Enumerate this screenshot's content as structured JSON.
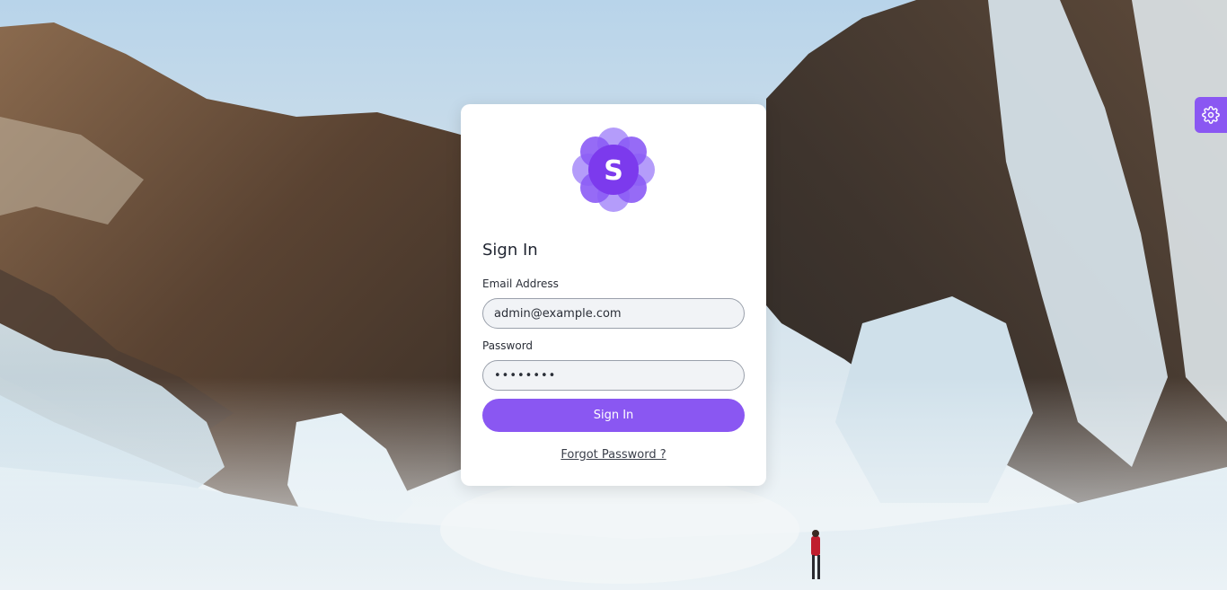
{
  "login": {
    "logo_letter": "S",
    "title": "Sign In",
    "email_label": "Email Address",
    "email_value": "admin@example.com",
    "password_label": "Password",
    "password_value": "password",
    "submit_label": "Sign In",
    "forgot_label": "Forgot Password ?"
  },
  "icons": {
    "settings": "gear-icon",
    "logo": "flower-logo-icon"
  },
  "colors": {
    "accent": "#8a57f2",
    "logo_dark": "#7c3aed",
    "logo_light": "#a78bfa"
  }
}
